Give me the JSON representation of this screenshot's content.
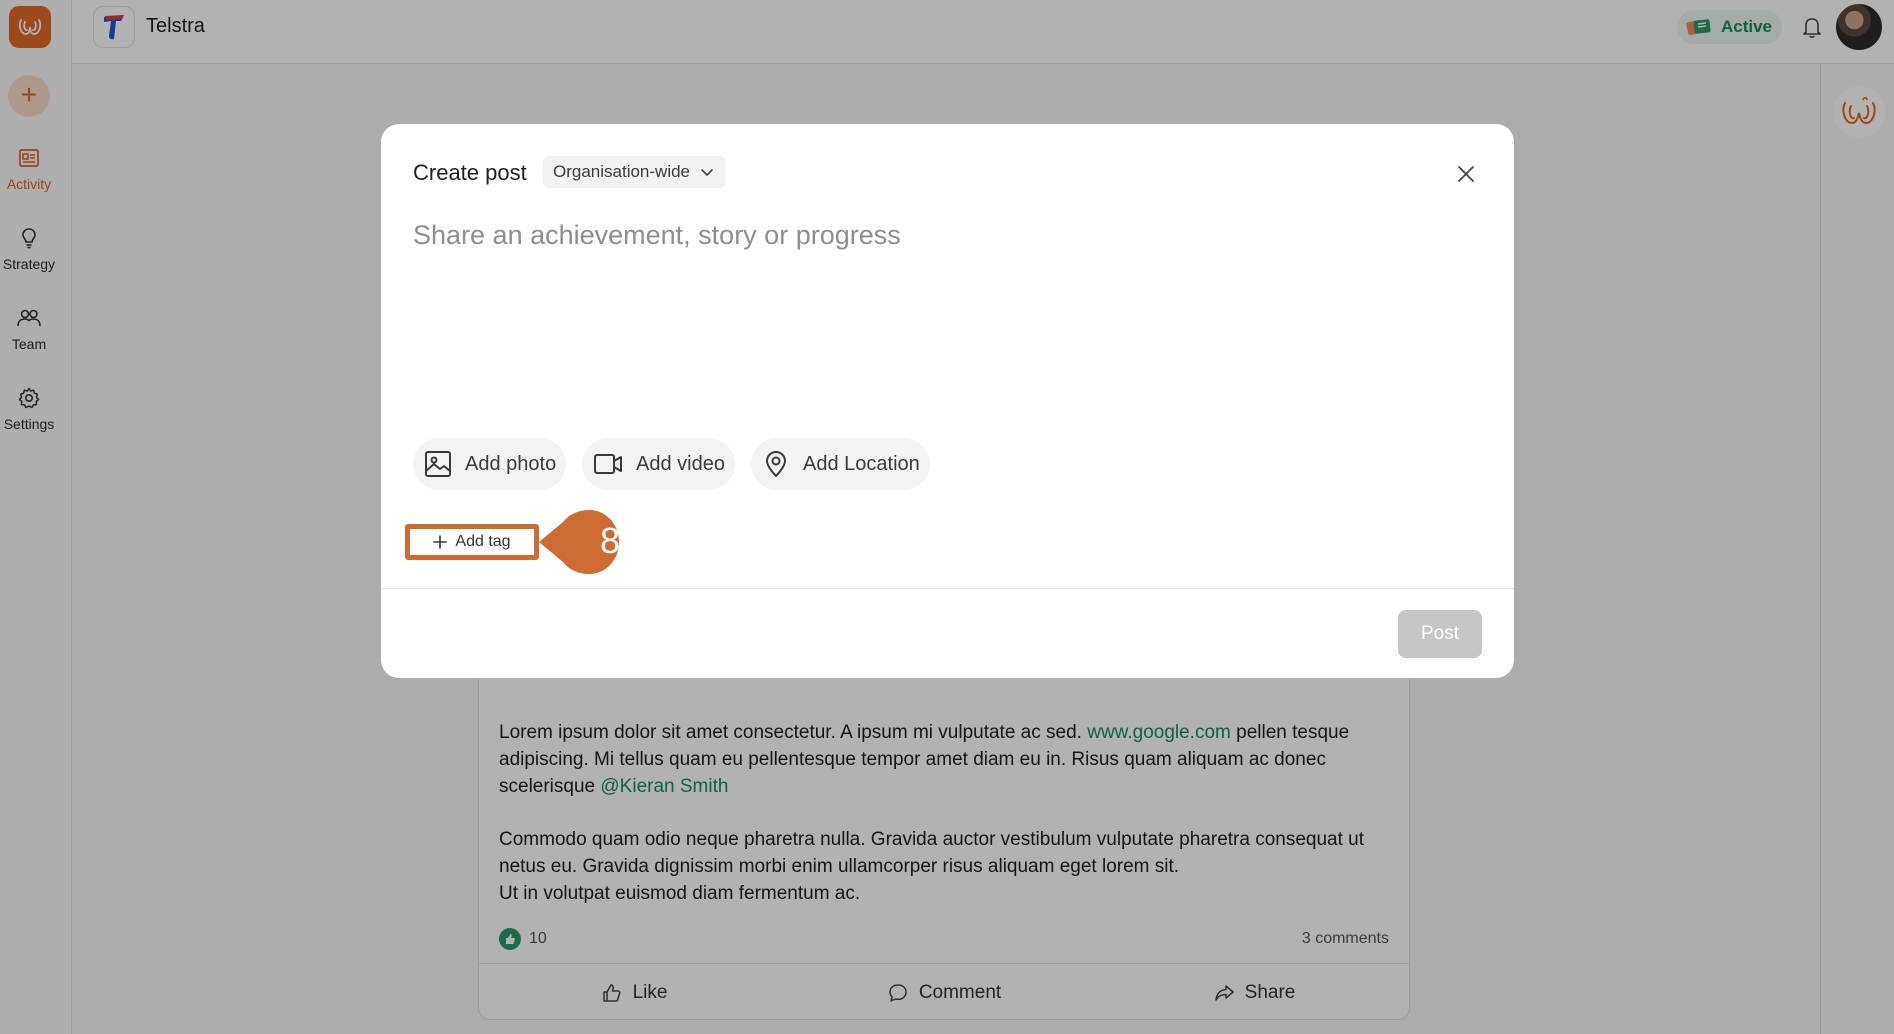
{
  "sidebar": {
    "items": [
      {
        "label": "Activity",
        "icon": "activity-icon"
      },
      {
        "label": "Strategy",
        "icon": "lightbulb-icon"
      },
      {
        "label": "Team",
        "icon": "team-icon"
      },
      {
        "label": "Settings",
        "icon": "gear-icon"
      }
    ],
    "active": "Activity"
  },
  "header": {
    "org_name": "Telstra",
    "status_label": "Active"
  },
  "post": {
    "paragraph1_text": "Lorem ipsum dolor sit amet consectetur. A ipsum mi vulputate ac sed.",
    "paragraph1_link": "www.google.com",
    "paragraph1_cont": "pellen tesque adipiscing. Mi tellus quam eu pellentesque tempor amet diam eu in. Risus quam aliquam ac donec scelerisque",
    "mention": "@Kieran Smith",
    "paragraph2_line1": "Commodo quam odio neque pharetra nulla. Gravida auctor vestibulum vulputate pharetra consequat ut netus eu. Gravida dignissim morbi enim ullamcorper risus aliquam eget lorem sit.",
    "paragraph2_line2": "Ut in volutpat euismod diam fermentum ac.",
    "likes": "10",
    "comments": "3 comments",
    "actions": {
      "like": "Like",
      "comment": "Comment",
      "share": "Share"
    }
  },
  "modal": {
    "title": "Create post",
    "visibility": "Organisation-wide",
    "placeholder": "Share an achievement, story or progress",
    "add_photo": "Add photo",
    "add_video": "Add video",
    "add_location": "Add Location",
    "add_tag": "Add tag",
    "step_number": "8",
    "post_label": "Post"
  },
  "colors": {
    "brand": "#e06a25",
    "accent_green": "#1c8a5b",
    "callout": "#cd6b34"
  }
}
